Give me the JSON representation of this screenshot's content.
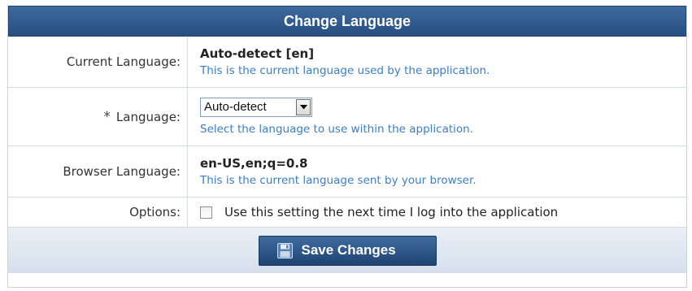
{
  "title": "Change Language",
  "current_language": {
    "label": "Current Language:",
    "value": "Auto-detect [en]",
    "help": "This is the current language used by the application."
  },
  "language": {
    "required_marker": "*",
    "label": "Language:",
    "selected": "Auto-detect",
    "help": "Select the language to use within the application."
  },
  "browser_language": {
    "label": "Browser Language:",
    "value": "en-US,en;q=0.8",
    "help": "This is the current language sent by your browser."
  },
  "options": {
    "label": "Options:",
    "checkbox_label": "Use this setting the next time I log into the application",
    "checked": false
  },
  "footer": {
    "save_label": "Save Changes"
  },
  "icons": {
    "save": "floppy-disk-icon",
    "dropdown": "chevron-down-icon"
  },
  "colors": {
    "header_bg": "#2f5a8c",
    "help_text": "#3c7ec4",
    "button_bg": "#2b5285"
  }
}
